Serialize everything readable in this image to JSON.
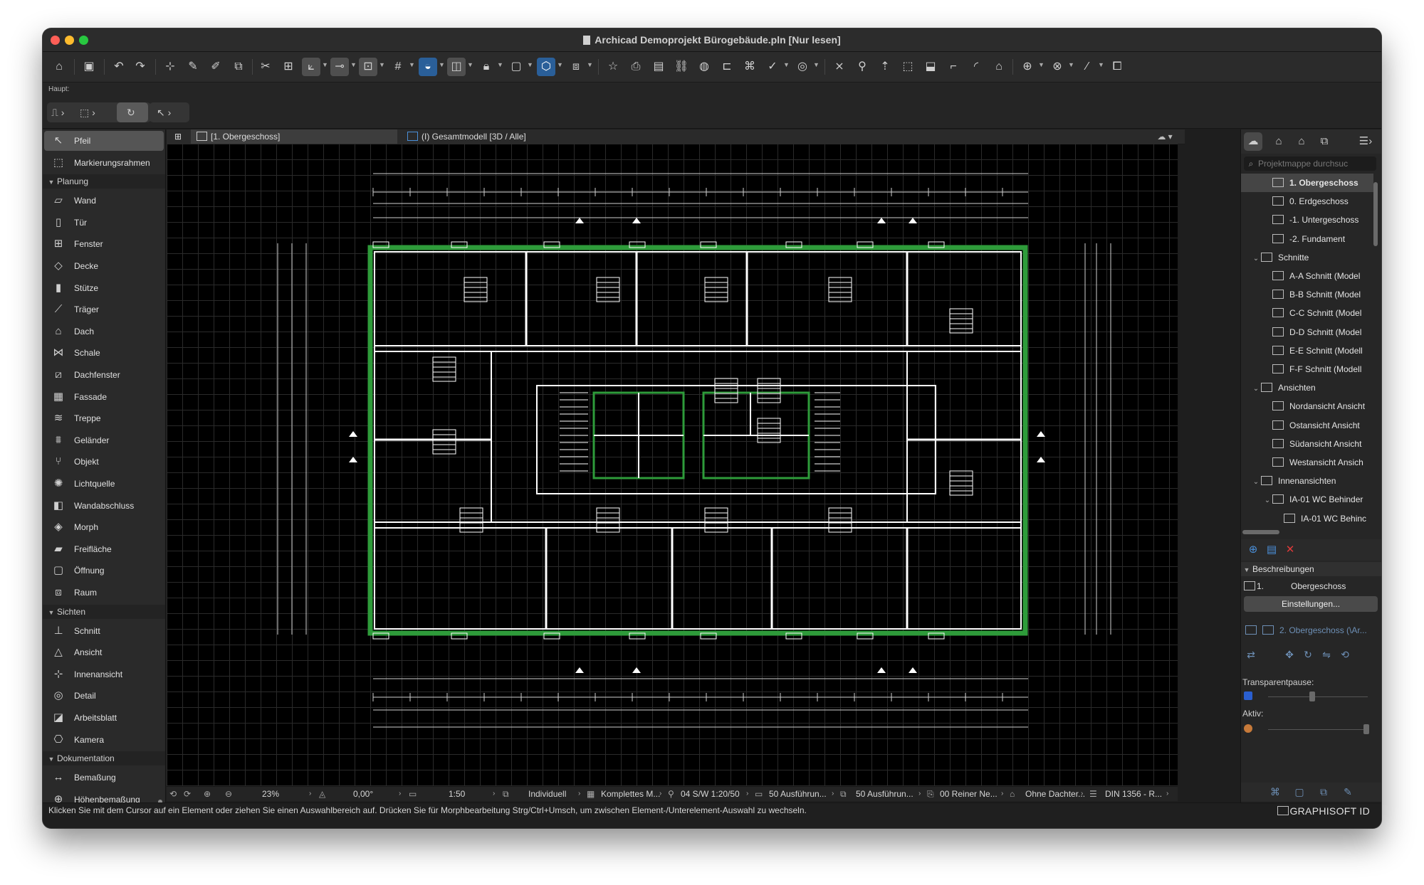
{
  "window": {
    "title": "Archicad Demoprojekt Bürogebäude.pln [Nur lesen]"
  },
  "toolbar2": {
    "label": "Haupt:"
  },
  "tool_palette": {
    "selected": "Pfeil",
    "top_tools": [
      {
        "label": "Pfeil",
        "icon": "arrow-pointer-icon"
      },
      {
        "label": "Markierungsrahmen",
        "icon": "marquee-icon"
      }
    ],
    "sections": [
      {
        "title": "Planung",
        "items": [
          "Wand",
          "Tür",
          "Fenster",
          "Decke",
          "Stütze",
          "Träger",
          "Dach",
          "Schale",
          "Dachfenster",
          "Fassade",
          "Treppe",
          "Geländer",
          "Objekt",
          "Lichtquelle",
          "Wandabschluss",
          "Morph",
          "Freifläche",
          "Öffnung",
          "Raum"
        ]
      },
      {
        "title": "Sichten",
        "items": [
          "Schnitt",
          "Ansicht",
          "Innenansicht",
          "Detail",
          "Arbeitsblatt",
          "Kamera"
        ]
      },
      {
        "title": "Dokumentation",
        "items": [
          "Bemaßung",
          "Höhenbemaßung"
        ]
      }
    ]
  },
  "tabs": [
    {
      "label": "[1. Obergeschoss]",
      "active": true
    },
    {
      "label": "(I) Gesamtmodell [3D / Alle]",
      "active": false
    }
  ],
  "navigator": {
    "search_placeholder": "Projektmappe durchsuc",
    "tree": [
      {
        "label": "1. Obergeschoss",
        "level": 2,
        "selected": true
      },
      {
        "label": "0. Erdgeschoss",
        "level": 2
      },
      {
        "label": "-1. Untergeschoss",
        "level": 2
      },
      {
        "label": "-2. Fundament",
        "level": 2
      },
      {
        "label": "Schnitte",
        "level": 1,
        "caret": true
      },
      {
        "label": "A-A Schnitt (Model",
        "level": 2
      },
      {
        "label": "B-B Schnitt (Model",
        "level": 2
      },
      {
        "label": "C-C Schnitt (Model",
        "level": 2
      },
      {
        "label": "D-D Schnitt (Model",
        "level": 2
      },
      {
        "label": "E-E Schnitt (Modell",
        "level": 2
      },
      {
        "label": "F-F Schnitt (Modell",
        "level": 2
      },
      {
        "label": "Ansichten",
        "level": 1,
        "caret": true
      },
      {
        "label": "Nordansicht Ansicht",
        "level": 2
      },
      {
        "label": "Ostansicht Ansicht",
        "level": 2
      },
      {
        "label": "Südansicht Ansicht",
        "level": 2
      },
      {
        "label": "Westansicht Ansich",
        "level": 2
      },
      {
        "label": "Innenansichten",
        "level": 1,
        "caret": true
      },
      {
        "label": "IA-01 WC Behinder",
        "level": 2,
        "caret": true
      },
      {
        "label": "IA-01 WC Behinc",
        "level": 3
      }
    ],
    "descriptions_label": "Beschreibungen",
    "story_number": "1.",
    "story_name": "Obergeschoss",
    "settings_button": "Einstellungen...",
    "layer_text": "2. Obergeschoss (\\Ar...",
    "transparency_label": "Transparentpause:",
    "active_label": "Aktiv:"
  },
  "statusbar": {
    "zoom": "23%",
    "angle": "0,00°",
    "scale": "1:50",
    "items": [
      "Individuell",
      "Komplettes M...",
      "04 S/W 1:20/50",
      "50 Ausführun...",
      "50 Ausführun...",
      "00 Reiner Ne...",
      "Ohne Dachter...",
      "DIN 1356 - R..."
    ]
  },
  "hint": "Klicken Sie mit dem Cursor auf ein Element oder ziehen Sie einen Auswahlbereich auf. Drücken Sie für Morphbearbeitung Strg/Ctrl+Umsch, um zwischen Element-/Unterelement-Auswahl zu wechseln.",
  "brand": "GRAPHISOFT ID",
  "colors": {
    "canvas_bg": "#000000",
    "grid": "#2a2a2a",
    "walls": "#ffffff",
    "outline_green": "#2e9b3a",
    "accent_blue": "#2a5f99",
    "delete_red": "#e03a3a"
  }
}
